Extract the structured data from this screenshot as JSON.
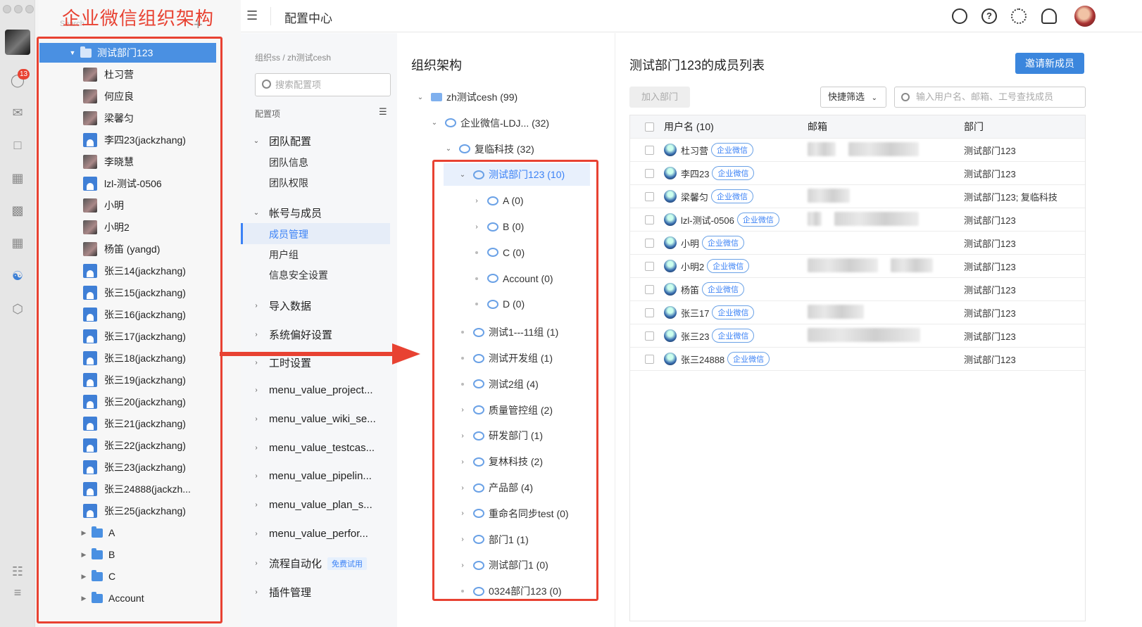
{
  "wecom": {
    "annotation_title": "企业微信组织架构",
    "search_placeholder": "Search",
    "unread_badge": "13",
    "tree": [
      {
        "label": "测试部门123",
        "type": "folder",
        "selected": true,
        "expanded": true
      },
      {
        "label": "杜习营",
        "type": "photo"
      },
      {
        "label": "何应良",
        "type": "photo"
      },
      {
        "label": "梁馨匀",
        "type": "photo"
      },
      {
        "label": "李四23(jackzhang)",
        "type": "person"
      },
      {
        "label": "李晓慧",
        "type": "photo"
      },
      {
        "label": "lzl-测试-0506",
        "type": "person"
      },
      {
        "label": "小明",
        "type": "photo"
      },
      {
        "label": "小明2",
        "type": "photo"
      },
      {
        "label": "杨笛 (yangd)",
        "type": "photo"
      },
      {
        "label": "张三14(jackzhang)",
        "type": "person"
      },
      {
        "label": "张三15(jackzhang)",
        "type": "person"
      },
      {
        "label": "张三16(jackzhang)",
        "type": "person"
      },
      {
        "label": "张三17(jackzhang)",
        "type": "person"
      },
      {
        "label": "张三18(jackzhang)",
        "type": "person"
      },
      {
        "label": "张三19(jackzhang)",
        "type": "person"
      },
      {
        "label": "张三20(jackzhang)",
        "type": "person"
      },
      {
        "label": "张三21(jackzhang)",
        "type": "person"
      },
      {
        "label": "张三22(jackzhang)",
        "type": "person"
      },
      {
        "label": "张三23(jackzhang)",
        "type": "person"
      },
      {
        "label": "张三24888(jackzh...",
        "type": "person"
      },
      {
        "label": "张三25(jackzhang)",
        "type": "person"
      },
      {
        "label": "A",
        "type": "subfolder"
      },
      {
        "label": "B",
        "type": "subfolder"
      },
      {
        "label": "C",
        "type": "subfolder"
      },
      {
        "label": "Account",
        "type": "subfolder"
      }
    ]
  },
  "header": {
    "title": "配置中心"
  },
  "config": {
    "breadcrumb": "组织ss / zh测试cesh",
    "search_placeholder": "搜索配置项",
    "section_label": "配置项",
    "team_group": "团队配置",
    "team_items": [
      "团队信息",
      "团队权限"
    ],
    "account_group": "帐号与成员",
    "account_items": [
      "成员管理",
      "用户组",
      "信息安全设置"
    ],
    "collapsed_groups": [
      "导入数据",
      "系统偏好设置",
      "工时设置",
      "menu_value_project...",
      "menu_value_wiki_se...",
      "menu_value_testcas...",
      "menu_value_pipelin...",
      "menu_value_plan_s...",
      "menu_value_perfor...",
      "流程自动化",
      "插件管理"
    ],
    "free_trial_badge": "免费试用"
  },
  "org": {
    "title": "组织架构",
    "nodes": [
      {
        "label": "zh测试cesh (99)",
        "depth": 0,
        "toggle": "open",
        "icon": "folder"
      },
      {
        "label": "企业微信-LDJ...   (32)",
        "depth": 1,
        "toggle": "open",
        "icon": "bubble"
      },
      {
        "label": "复临科技 (32)",
        "depth": 2,
        "toggle": "open",
        "icon": "bubble"
      },
      {
        "label": "测试部门123 (10)",
        "depth": 3,
        "toggle": "open",
        "icon": "bubble",
        "selected": true
      },
      {
        "label": "A (0)",
        "depth": 4,
        "toggle": "closed",
        "icon": "bubble"
      },
      {
        "label": "B (0)",
        "depth": 4,
        "toggle": "closed",
        "icon": "bubble"
      },
      {
        "label": "C (0)",
        "depth": 4,
        "toggle": "none",
        "icon": "bubble"
      },
      {
        "label": "Account (0)",
        "depth": 4,
        "toggle": "none",
        "icon": "bubble"
      },
      {
        "label": "D (0)",
        "depth": 4,
        "toggle": "none",
        "icon": "bubble"
      },
      {
        "label": "测试1---11组 (1)",
        "depth": 3,
        "toggle": "none",
        "icon": "bubble"
      },
      {
        "label": "测试开发组 (1)",
        "depth": 3,
        "toggle": "none",
        "icon": "bubble"
      },
      {
        "label": "测试2组 (4)",
        "depth": 3,
        "toggle": "none",
        "icon": "bubble"
      },
      {
        "label": "质量管控组 (2)",
        "depth": 3,
        "toggle": "closed",
        "icon": "bubble"
      },
      {
        "label": "研发部门 (1)",
        "depth": 3,
        "toggle": "closed",
        "icon": "bubble"
      },
      {
        "label": "复林科技 (2)",
        "depth": 3,
        "toggle": "closed",
        "icon": "bubble"
      },
      {
        "label": "产品部 (4)",
        "depth": 3,
        "toggle": "closed",
        "icon": "bubble"
      },
      {
        "label": "重命名同步test (0)",
        "depth": 3,
        "toggle": "closed",
        "icon": "bubble"
      },
      {
        "label": "部门1 (1)",
        "depth": 3,
        "toggle": "closed",
        "icon": "bubble"
      },
      {
        "label": "测试部门1 (0)",
        "depth": 3,
        "toggle": "closed",
        "icon": "bubble"
      },
      {
        "label": "0324部门123 (0)",
        "depth": 3,
        "toggle": "none",
        "icon": "bubble"
      }
    ]
  },
  "members": {
    "title": "测试部门123的成员列表",
    "invite_label": "邀请新成员",
    "join_label": "加入部门",
    "filter_label": "快捷筛选",
    "search_placeholder": "输入用户名、邮箱、工号查找成员",
    "columns": [
      "用户名 (10)",
      "邮箱",
      "部门"
    ],
    "tag_label": "企业微信",
    "rows": [
      {
        "name": "杜习营",
        "dept": "测试部门123"
      },
      {
        "name": "李四23",
        "dept": "测试部门123"
      },
      {
        "name": "梁馨匀",
        "dept": "测试部门123; 复临科技"
      },
      {
        "name": "lzl-测试-0506",
        "dept": "测试部门123"
      },
      {
        "name": "小明",
        "dept": "测试部门123"
      },
      {
        "name": "小明2",
        "dept": "测试部门123"
      },
      {
        "name": "杨笛",
        "dept": "测试部门123"
      },
      {
        "name": "张三17",
        "dept": "测试部门123"
      },
      {
        "name": "张三23",
        "dept": "测试部门123"
      },
      {
        "name": "张三24888",
        "dept": "测试部门123"
      }
    ]
  },
  "colors": {
    "accent": "#3b82f6",
    "annotation": "#e84232",
    "wecom_selected": "#4a90e2"
  }
}
